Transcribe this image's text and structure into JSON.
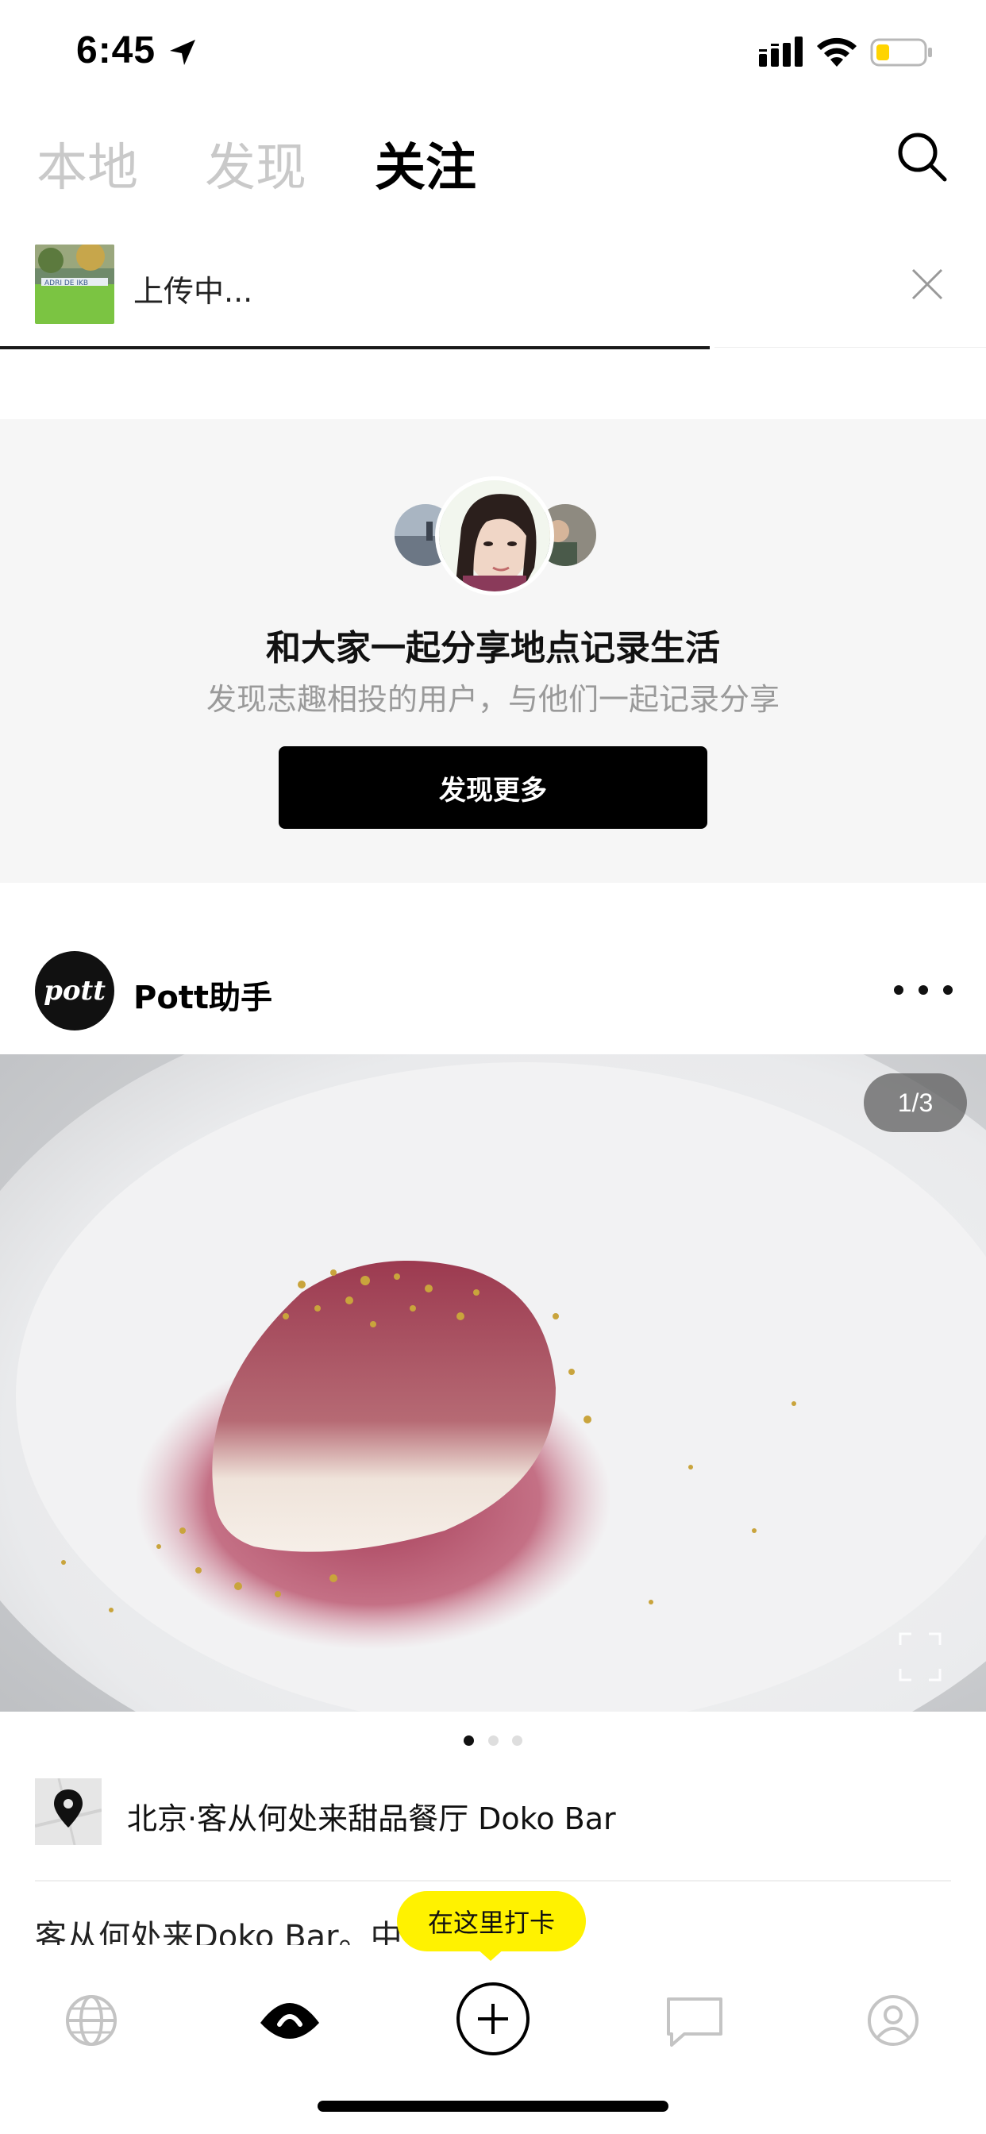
{
  "status_bar": {
    "time": "6:45",
    "icons": [
      "location-arrow-icon",
      "signal-icon",
      "wifi-icon",
      "battery-icon"
    ],
    "battery_color": "#ffd400"
  },
  "top_tabs": {
    "items": [
      {
        "label": "本地",
        "active": false
      },
      {
        "label": "发现",
        "active": false
      },
      {
        "label": "关注",
        "active": true
      }
    ],
    "search_icon": "search-icon"
  },
  "upload": {
    "status_text": "上传中...",
    "progress": 0.72,
    "close_icon": "close-icon"
  },
  "suggest_card": {
    "title": "和大家一起分享地点记录生活",
    "subtitle": "发现志趣相投的用户，与他们一起记录分享",
    "button_label": "发现更多"
  },
  "post": {
    "author": "Pott助手",
    "avatar_text": "pott",
    "page_indicator": "1/3",
    "image_count": 3,
    "current_image": 1,
    "location": "北京·客从何处来甜品餐厅 Doko Bar",
    "caption": "客从何处来Doko Bar。中                    店。"
  },
  "checkin_tooltip": "在这里打卡",
  "bottom_nav": {
    "items": [
      {
        "icon": "globe-icon",
        "active": false
      },
      {
        "icon": "eye-icon",
        "active": true
      },
      {
        "icon": "add-icon",
        "active": false
      },
      {
        "icon": "message-icon",
        "active": false
      },
      {
        "icon": "profile-icon",
        "active": false
      }
    ]
  },
  "colors": {
    "accent_yellow": "#fff200",
    "inactive_tab": "#c9c9c9",
    "subtitle_gray": "#9a9a9a"
  }
}
